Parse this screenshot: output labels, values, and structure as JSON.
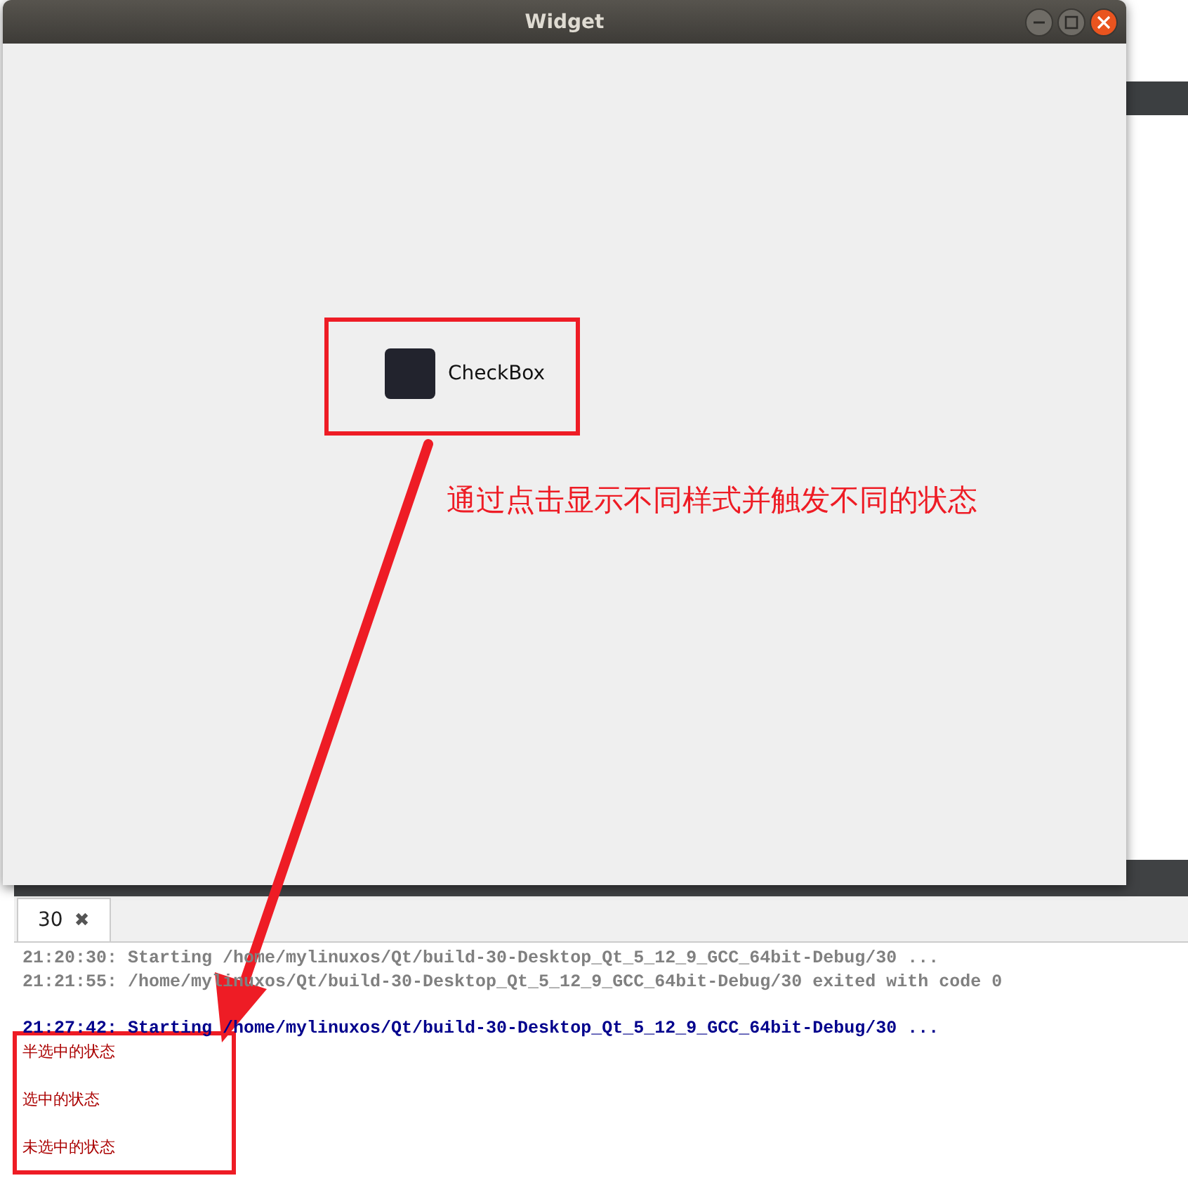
{
  "window": {
    "title": "Widget",
    "checkbox": {
      "label": "CheckBox",
      "checked": false
    }
  },
  "output_pane": {
    "tabs": [
      {
        "label": "30",
        "close": "✖",
        "selected": true
      }
    ],
    "lines": [
      {
        "kind": "info",
        "text": "21:20:30: Starting /home/mylinuxos/Qt/build-30-Desktop_Qt_5_12_9_GCC_64bit-Debug/30 ..."
      },
      {
        "kind": "info",
        "text": "21:21:55: /home/mylinuxos/Qt/build-30-Desktop_Qt_5_12_9_GCC_64bit-Debug/30 exited with code 0"
      },
      {
        "kind": "blank"
      },
      {
        "kind": "start",
        "text": "21:27:42: Starting /home/mylinuxos/Qt/build-30-Desktop_Qt_5_12_9_GCC_64bit-Debug/30 ..."
      },
      {
        "kind": "output",
        "text": "半选中的状态"
      },
      {
        "kind": "output",
        "text": "选中的状态"
      },
      {
        "kind": "output",
        "text": "未选中的状态"
      }
    ]
  },
  "annotation": {
    "caption": "通过点击显示不同样式并触发不同的状态"
  }
}
